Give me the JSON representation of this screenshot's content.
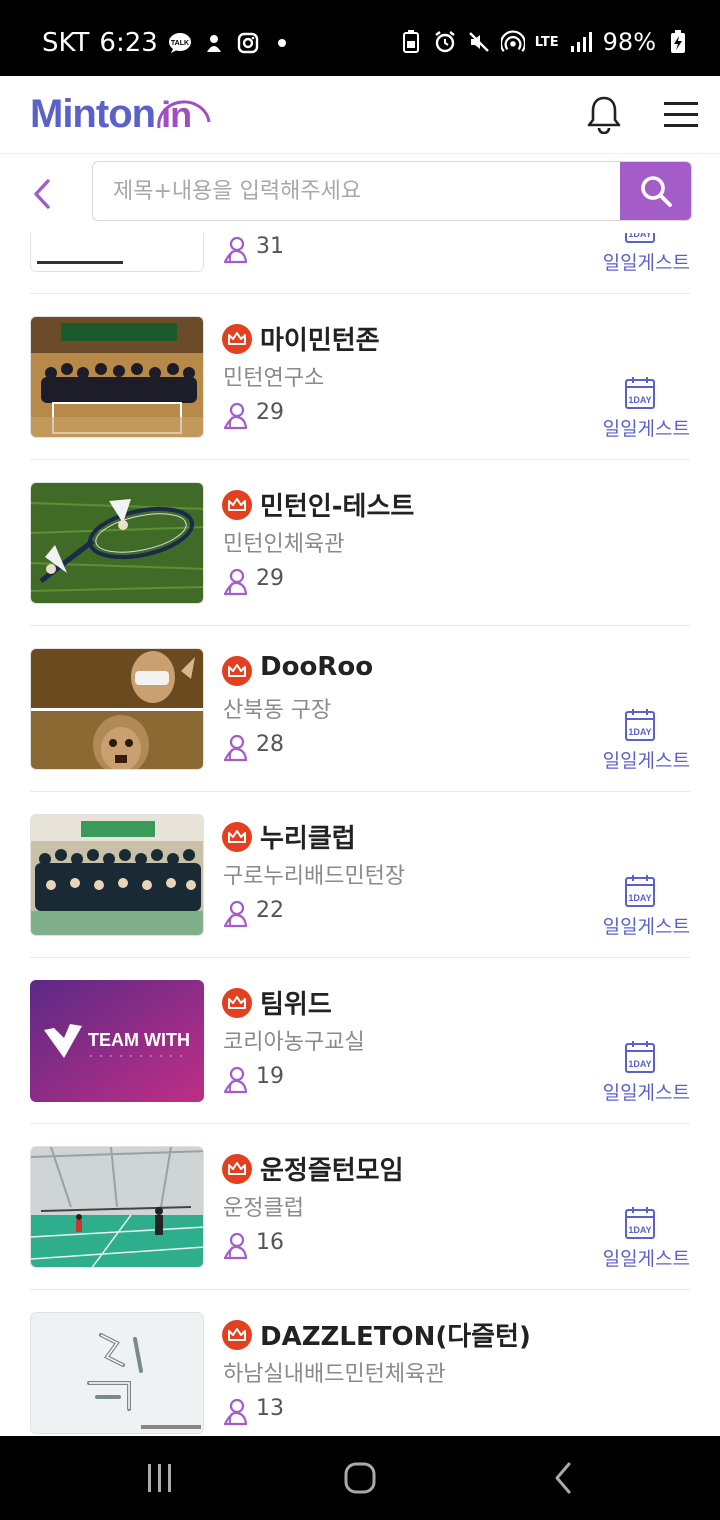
{
  "status_bar": {
    "carrier": "SKT",
    "time": "6:23",
    "network": "LTE",
    "battery": "98%",
    "left_icons": [
      "talk-icon",
      "notification-icon",
      "instagram-icon",
      "dot-icon"
    ],
    "right_icons": [
      "lock-battery-icon",
      "alarm-icon",
      "mute-icon",
      "hotspot-icon",
      "signal-icon",
      "battery-charging-icon"
    ]
  },
  "header": {
    "logo_text": "Minton",
    "logo_suffix": "in",
    "brand_color": "#5a62c9",
    "accent_color": "#a45cc9"
  },
  "search": {
    "placeholder": "제목+내용을 입력해주세요",
    "value": ""
  },
  "clubs": [
    {
      "name": "",
      "location": "",
      "members": "31",
      "guest": "일일게스트",
      "thumb": "partial",
      "has_crown": false,
      "partial_top": true
    },
    {
      "name": "마이민턴존",
      "location": "민턴연구소",
      "members": "29",
      "guest": "일일게스트",
      "thumb": "group-photo"
    },
    {
      "name": "민턴인-테스트",
      "location": "민턴인체육관",
      "members": "29",
      "guest": "",
      "thumb": "racket-grass"
    },
    {
      "name": "DooRoo",
      "location": "산북동 구장",
      "members": "28",
      "guest": "일일게스트",
      "thumb": "mona-lisa"
    },
    {
      "name": "누리클럽",
      "location": "구로누리배드민턴장",
      "members": "22",
      "guest": "일일게스트",
      "thumb": "team-photo"
    },
    {
      "name": "팀위드",
      "location": "코리아농구교실",
      "members": "19",
      "guest": "일일게스트",
      "thumb": "team-with-logo",
      "thumb_text": "TEAM WITH"
    },
    {
      "name": "운정즐턴모임",
      "location": "운정클럽",
      "members": "16",
      "guest": "일일게스트",
      "thumb": "court-photo"
    },
    {
      "name": "DAZZLETON(다즐턴)",
      "location": "하남실내배드민턴체육관",
      "members": "13",
      "guest": "",
      "thumb": "dazzle-poster"
    }
  ],
  "calendar_badge_text": "1DAY",
  "nav": {
    "buttons": [
      "recent-apps-icon",
      "home-icon",
      "back-nav-icon"
    ]
  }
}
